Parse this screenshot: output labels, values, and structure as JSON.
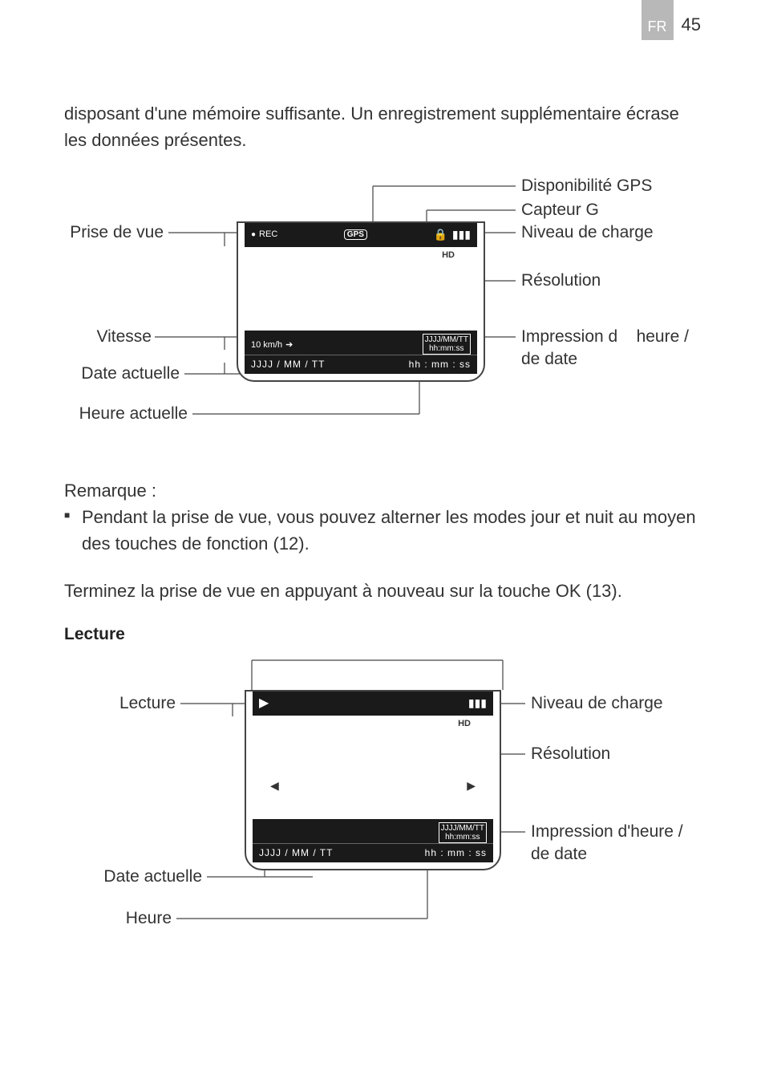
{
  "header": {
    "lang": "FR",
    "page": "45"
  },
  "intro": "disposant d'une mémoire suffisante. Un enregistrement supplémentaire écrase les données présentes.",
  "diagram1": {
    "left_labels": {
      "prise": "Prise de vue",
      "vitesse": "Vitesse",
      "date": "Date actuelle",
      "heure": "Heure actuelle"
    },
    "right_labels": {
      "gps": "Disponibilité GPS",
      "capteur": "Capteur G",
      "charge": "Niveau de charge",
      "resolution": "Résolution",
      "impression1": "Impression d",
      "impression2": "heure /",
      "impression3": "de date"
    },
    "screen": {
      "rec": "REC",
      "gps": "GPS",
      "hd": "HD",
      "speed": "10 km/h",
      "stamp1": "JJJJ/MM/TT",
      "stamp2": "hh:mm:ss",
      "bottom_date": "JJJJ / MM / TT",
      "bottom_time": "hh : mm : ss"
    }
  },
  "remarque": {
    "heading": "Remarque :",
    "bullet": "Pendant la prise de vue, vous pouvez alterner les modes jour et nuit au moyen des touches de fonction (12)."
  },
  "terminez": "Terminez la prise de vue en appuyant à nouveau sur la touche OK (13).",
  "lecture_heading": "Lecture",
  "diagram2": {
    "left_labels": {
      "lecture": "Lecture",
      "date": "Date actuelle",
      "heure": "Heure"
    },
    "right_labels": {
      "charge": "Niveau de charge",
      "resolution": "Résolution",
      "impression1": "Impression d'heure /",
      "impression2": "de date"
    },
    "screen": {
      "hd": "HD",
      "stamp1": "JJJJ/MM/TT",
      "stamp2": "hh:mm:ss",
      "bottom_date": "JJJJ / MM / TT",
      "bottom_time": "hh : mm : ss"
    }
  }
}
